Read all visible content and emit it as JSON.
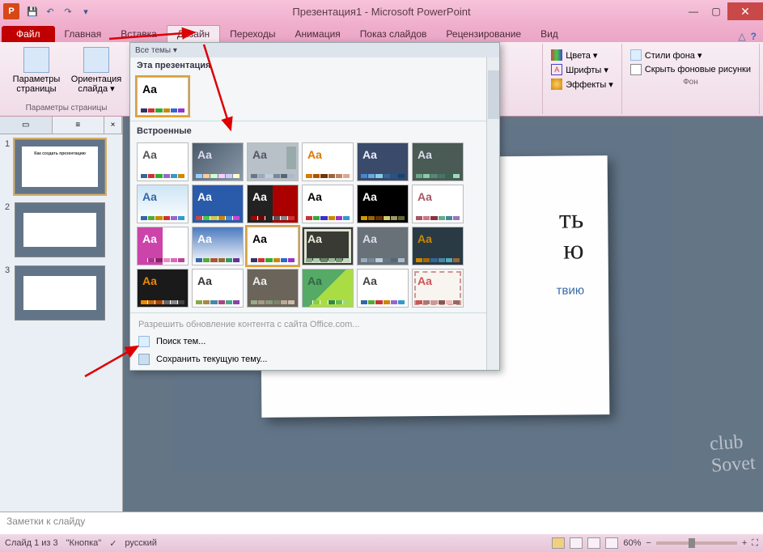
{
  "title": "Презентация1 - Microsoft PowerPoint",
  "qat": {
    "save": "💾",
    "undo": "↶",
    "redo": "↷",
    "more": "▾"
  },
  "tabs": {
    "file": "Файл",
    "items": [
      "Главная",
      "Вставка",
      "Дизайн",
      "Переходы",
      "Анимация",
      "Показ слайдов",
      "Рецензирование",
      "Вид"
    ],
    "active": "Дизайн"
  },
  "ribbon": {
    "page_params": "Параметры страницы",
    "page_params_btn": "Параметры страницы",
    "orientation": "Ориентация слайда ▾",
    "colors": "Цвета ▾",
    "fonts": "Шрифты ▾",
    "effects": "Эффекты ▾",
    "bg_styles": "Стили фона ▾",
    "hide_bg": "Скрыть фоновые рисунки",
    "bg_group": "Фон"
  },
  "themes_dd": {
    "all_themes": "Все темы ▾",
    "this_presentation": "Эта презентация",
    "builtin": "Встроенные",
    "office_update": "Разрешить обновление контента с сайта Office.com...",
    "browse": "Поиск тем...",
    "save_theme": "Сохранить текущую тему..."
  },
  "slides_panel": {
    "close": "×"
  },
  "thumbs": [
    {
      "num": "1",
      "text": "Как создать презентацию"
    },
    {
      "num": "2",
      "text": ""
    },
    {
      "num": "3",
      "text": ""
    }
  ],
  "slide": {
    "title_part": "ть\nю",
    "subtitle_part": "твию"
  },
  "notes_placeholder": "Заметки к слайду",
  "status": {
    "slide_count": "Слайд 1 из 3",
    "theme": "\"Кнопка\"",
    "lang": "русский",
    "zoom": "60%"
  },
  "watermark": "club\nSovet"
}
